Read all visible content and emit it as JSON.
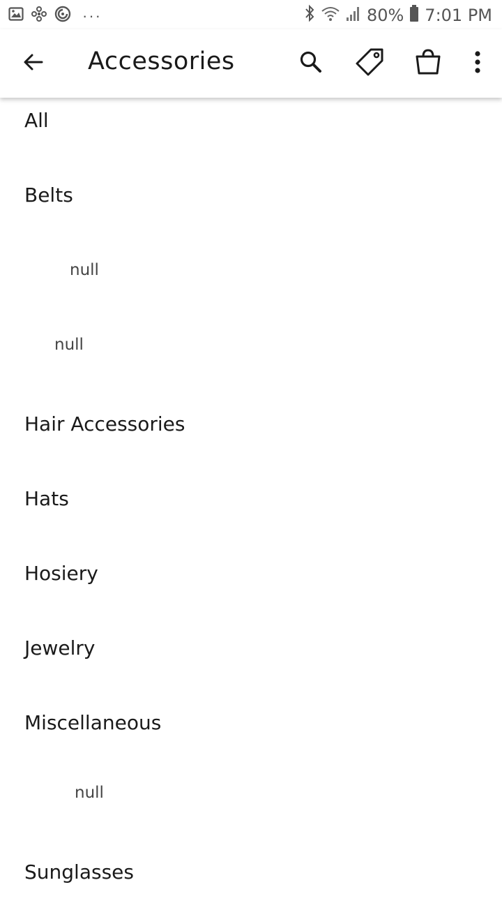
{
  "status_bar": {
    "battery": "80%",
    "time": "7:01 PM",
    "more": "···"
  },
  "header": {
    "title": "Accessories"
  },
  "categories": [
    {
      "label": "All"
    },
    {
      "label": "Belts"
    },
    {
      "label": "null"
    },
    {
      "label": "null"
    },
    {
      "label": "Hair Accessories"
    },
    {
      "label": "Hats"
    },
    {
      "label": "Hosiery"
    },
    {
      "label": "Jewelry"
    },
    {
      "label": "Miscellaneous"
    },
    {
      "label": "null"
    },
    {
      "label": "Sunglasses"
    }
  ]
}
